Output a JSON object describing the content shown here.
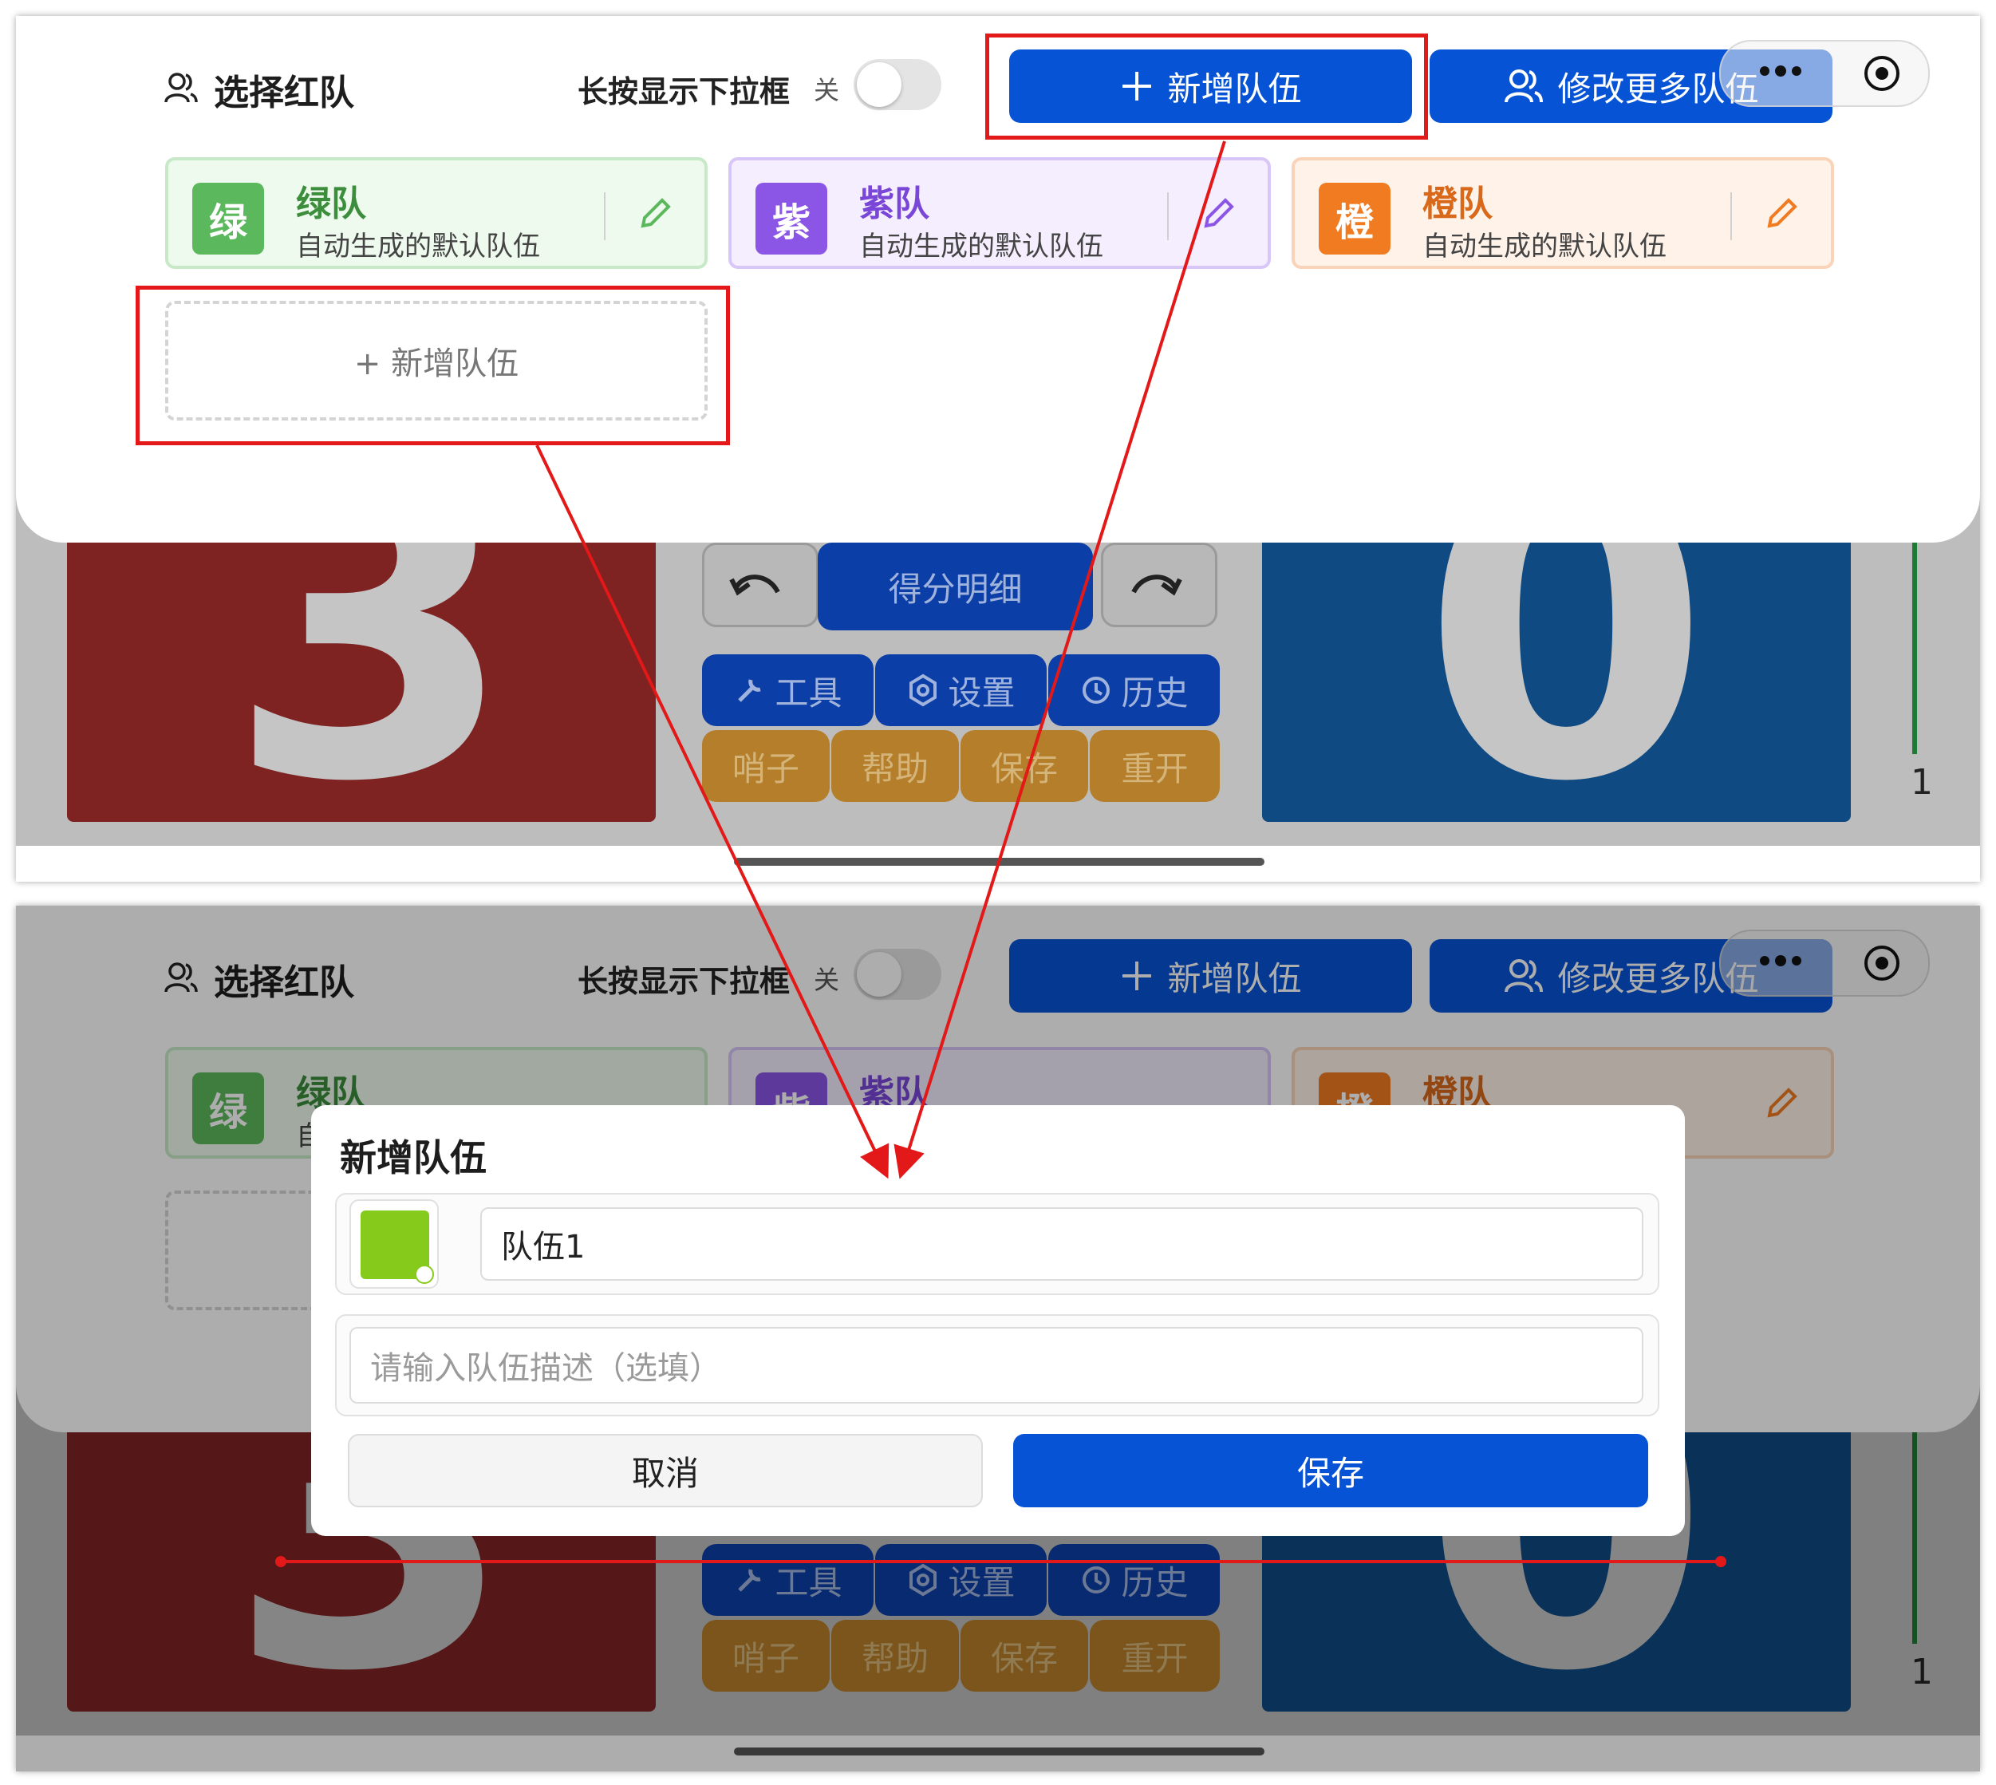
{
  "sheet": {
    "title": "选择红队",
    "toggle_label": "长按显示下拉框",
    "toggle_state": "关",
    "add_button": "新增队伍",
    "more_button": "修改更多队伍"
  },
  "teams": [
    {
      "badge": "绿",
      "name": "绿队",
      "desc": "自动生成的默认队伍",
      "color": "#5cb85c"
    },
    {
      "badge": "紫",
      "name": "紫队",
      "desc": "自动生成的默认队伍",
      "color": "#8b55e6"
    },
    {
      "badge": "橙",
      "name": "橙队",
      "desc": "自动生成的默认队伍",
      "color": "#f07b20"
    }
  ],
  "add_card_label": "+ 新增队伍",
  "controls": {
    "score_detail": "得分明细",
    "tools": "工具",
    "settings": "设置",
    "history": "历史",
    "whistle": "哨子",
    "help": "帮助",
    "save": "保存",
    "restart": "重开"
  },
  "side_number": "1",
  "modal": {
    "title": "新增队伍",
    "name_value": "队伍1",
    "desc_placeholder": "请输入队伍描述（选填）",
    "cancel": "取消",
    "save": "保存",
    "selected_color": "#86cb1c"
  },
  "colors": {
    "primary": "#0753d6",
    "highlight": "#e31818",
    "red_team_panel": "#7e2222",
    "blue_team_panel": "#0f4a82"
  }
}
